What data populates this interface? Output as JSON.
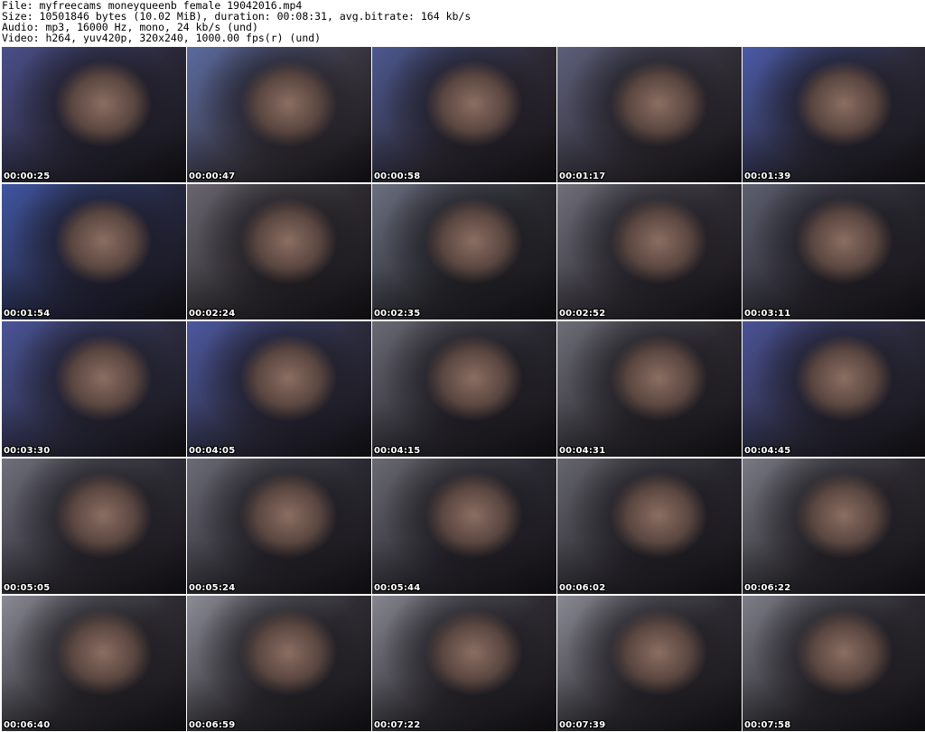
{
  "header": {
    "file": "File: myfreecams_moneyqueenb_female_19042016.mp4",
    "size": "Size: 10501846 bytes (10.02 MiB), duration: 00:08:31, avg.bitrate: 164 kb/s",
    "audio": "Audio: mp3, 16000 Hz, mono, 24 kb/s (und)",
    "video": "Video: h264, yuv420p, 320x240, 1000.00 fps(r) (und)"
  },
  "thumbnails": [
    {
      "timestamp": "00:00:25",
      "tone": "#2a2838",
      "accent": "#4a4f8a"
    },
    {
      "timestamp": "00:00:47",
      "tone": "#3a3640",
      "accent": "#5a6aa0"
    },
    {
      "timestamp": "00:00:58",
      "tone": "#2e2a35",
      "accent": "#4c5890"
    },
    {
      "timestamp": "00:01:17",
      "tone": "#332f38",
      "accent": "#5c5f7a"
    },
    {
      "timestamp": "00:01:39",
      "tone": "#2c2a38",
      "accent": "#4a5aa8"
    },
    {
      "timestamp": "00:01:54",
      "tone": "#262840",
      "accent": "#3f55a0"
    },
    {
      "timestamp": "00:02:24",
      "tone": "#2e2b30",
      "accent": "#6a6670"
    },
    {
      "timestamp": "00:02:35",
      "tone": "#2a2a30",
      "accent": "#6b7080"
    },
    {
      "timestamp": "00:02:52",
      "tone": "#302c34",
      "accent": "#70707a"
    },
    {
      "timestamp": "00:03:11",
      "tone": "#2a2830",
      "accent": "#5e6070"
    },
    {
      "timestamp": "00:03:30",
      "tone": "#2c2c40",
      "accent": "#4a5498"
    },
    {
      "timestamp": "00:04:05",
      "tone": "#2d2c3e",
      "accent": "#4c58a0"
    },
    {
      "timestamp": "00:04:15",
      "tone": "#2a2830",
      "accent": "#6a6a74"
    },
    {
      "timestamp": "00:04:31",
      "tone": "#2c2a30",
      "accent": "#6e6e78"
    },
    {
      "timestamp": "00:04:45",
      "tone": "#2b2a3a",
      "accent": "#4a5296"
    },
    {
      "timestamp": "00:05:05",
      "tone": "#2e2c34",
      "accent": "#70707c"
    },
    {
      "timestamp": "00:05:24",
      "tone": "#2c2a32",
      "accent": "#6c6c76"
    },
    {
      "timestamp": "00:05:44",
      "tone": "#2a2830",
      "accent": "#6a6a72"
    },
    {
      "timestamp": "00:06:02",
      "tone": "#29272e",
      "accent": "#66666e"
    },
    {
      "timestamp": "00:06:22",
      "tone": "#2c2a30",
      "accent": "#7a7a84"
    },
    {
      "timestamp": "00:06:40",
      "tone": "#2e2c32",
      "accent": "#8a8a94"
    },
    {
      "timestamp": "00:06:59",
      "tone": "#2f2d33",
      "accent": "#8c8c96"
    },
    {
      "timestamp": "00:07:22",
      "tone": "#2d2b31",
      "accent": "#868690"
    },
    {
      "timestamp": "00:07:39",
      "tone": "#2e2c32",
      "accent": "#8a8a94"
    },
    {
      "timestamp": "00:07:58",
      "tone": "#2c2a30",
      "accent": "#7e7e88"
    }
  ]
}
